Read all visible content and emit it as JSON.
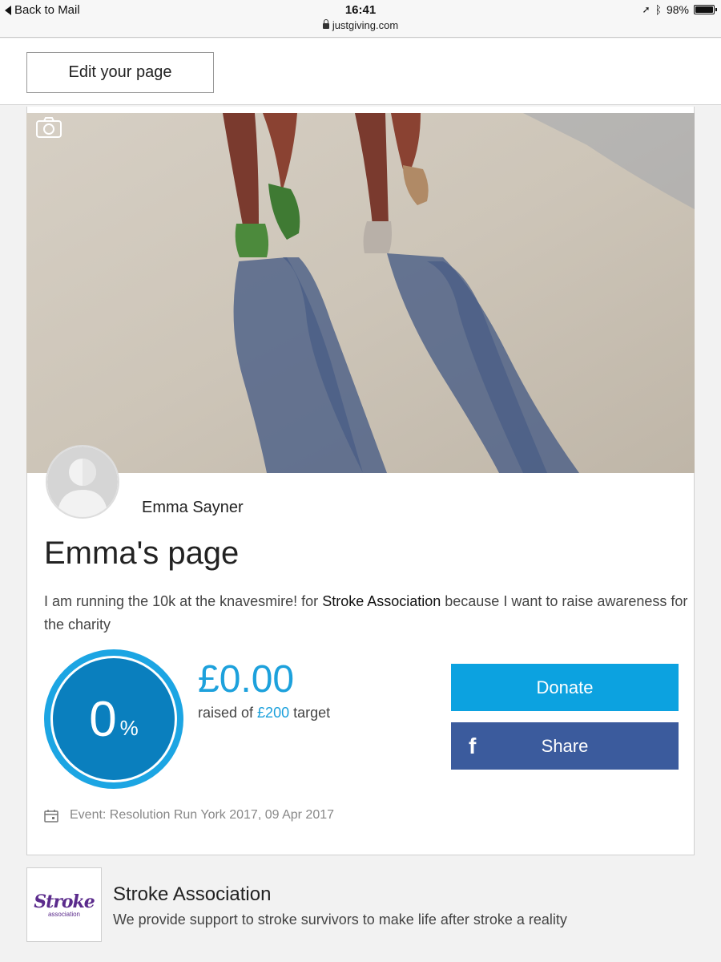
{
  "status_bar": {
    "back_label": "Back to Mail",
    "time": "16:41",
    "url": "justgiving.com",
    "battery": "98%",
    "battery_level": 0.98
  },
  "toolbar": {
    "edit_label": "Edit your page"
  },
  "profile": {
    "owner_name": "Emma Sayner",
    "page_title": "Emma's page",
    "story_before": "I am running the 10k at the knavesmire! for ",
    "charity_link": "Stroke Association",
    "story_after": " because I want to raise awareness for the charity"
  },
  "fundraising": {
    "percent": "0",
    "percent_sign": "%",
    "progress": 0,
    "raised": "£0.00",
    "target_prefix": "raised of ",
    "target_amount": "£200",
    "target_suffix": " target",
    "donate_label": "Donate",
    "share_label": "Share",
    "facebook_glyph": "f"
  },
  "event": {
    "text": "Event: Resolution Run York 2017, 09 Apr 2017"
  },
  "charity": {
    "logo_word": "Stroke",
    "logo_sub": "association",
    "name": "Stroke Association",
    "description": "We provide support to stroke survivors to make life after stroke a reality"
  },
  "colors": {
    "accent": "#0ca2e0",
    "facebook": "#3b5b9d",
    "charity_purple": "#5b2b8c"
  },
  "icons": [
    "camera-icon",
    "calendar-icon",
    "facebook-icon",
    "lock-icon",
    "location-arrow-icon",
    "bluetooth-icon",
    "battery-icon"
  ]
}
